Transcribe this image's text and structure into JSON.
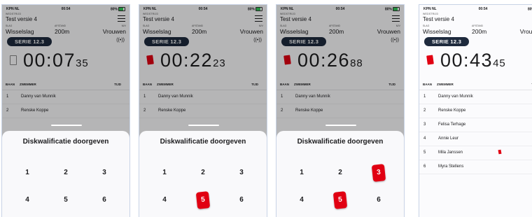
{
  "status": {
    "carrier": "KPN NL",
    "time": "00:54",
    "battery": "80%"
  },
  "race": {
    "label": "WEDSTRIJD",
    "name": "Test versie 4",
    "slag_label": "SLAG",
    "slag": "Wisselslag",
    "afstand_label": "AFSTAND",
    "afstand": "200m",
    "sex_label": "M/V",
    "sex": "Vrouwen",
    "serie": "SERIE 12.3",
    "signal_glyph": "((•))"
  },
  "table": {
    "col_baan": "BAAN",
    "col_zwemmer": "ZWEMMER",
    "col_tijd": "TIJD"
  },
  "swimmers": [
    {
      "lane": "1",
      "name": "Danny van Munnik"
    },
    {
      "lane": "2",
      "name": "Renske Koppe"
    },
    {
      "lane": "3",
      "name": "Felisa Terhage"
    },
    {
      "lane": "4",
      "name": "Annie Leur"
    },
    {
      "lane": "5",
      "name": "Mila Janssen"
    },
    {
      "lane": "6",
      "name": "Myra Stellens"
    }
  ],
  "sheet": {
    "title": "Diskwalificatie doorgeven",
    "keys": [
      "1",
      "2",
      "3",
      "4",
      "5",
      "6"
    ]
  },
  "frames": [
    {
      "timer_main": "00:07",
      "timer_frac": "35",
      "card": "empty",
      "selected_keys": []
    },
    {
      "timer_main": "00:22",
      "timer_frac": "23",
      "card": "red",
      "selected_keys": [
        "5"
      ]
    },
    {
      "timer_main": "00:26",
      "timer_frac": "88",
      "card": "red",
      "selected_keys": [
        "3",
        "5"
      ]
    },
    {
      "timer_main": "00:43",
      "timer_frac": "45",
      "card": "red",
      "selected_keys": [],
      "flagged_lane": "5"
    }
  ],
  "colors": {
    "accent": "#e10012",
    "serie_bg": "#1e2a3d"
  }
}
